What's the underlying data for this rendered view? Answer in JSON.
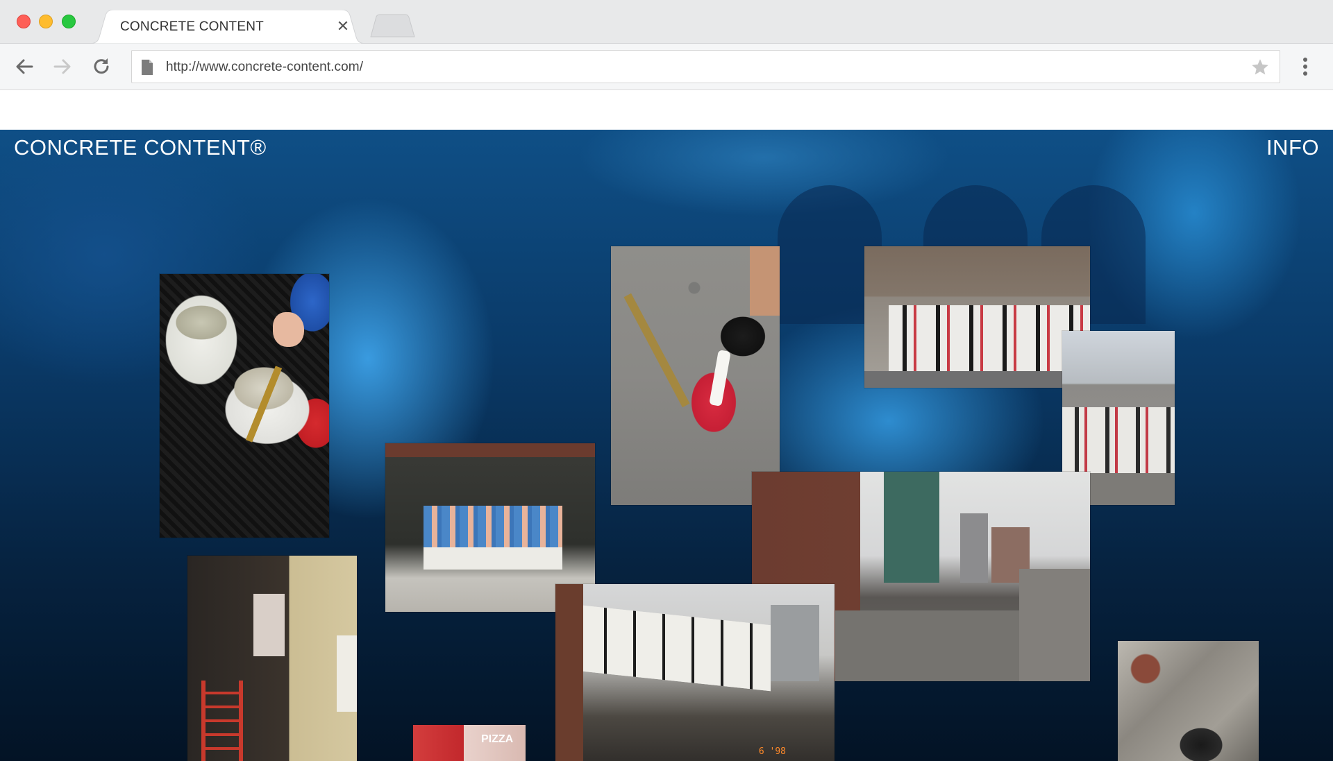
{
  "browser": {
    "tab": {
      "title": "CONCRETE CONTENT"
    },
    "address_bar": {
      "url": "http://www.concrete-content.com/"
    }
  },
  "page": {
    "brand": "CONCRETE CONTENT®",
    "nav": {
      "info_label": "INFO"
    },
    "photos": [
      {
        "name": "buckets-of-paste"
      },
      {
        "name": "pouring-paste"
      },
      {
        "name": "billboard-wall"
      },
      {
        "name": "billboard-wall-street"
      },
      {
        "name": "poster-wall-green"
      },
      {
        "name": "brick-building-skyline"
      },
      {
        "name": "storefront-ladder"
      },
      {
        "name": "crowd-at-poster-wall",
        "datestamp": "6 '98"
      },
      {
        "name": "pizza-sign",
        "sign_text": "PIZZA"
      },
      {
        "name": "rough-texture"
      }
    ]
  },
  "colors": {
    "background_blue": "#0f4f86",
    "brand_text": "#ffffff",
    "close_red": "#fe5f57",
    "minimize_yellow": "#febc2e",
    "zoom_green": "#28c840"
  }
}
